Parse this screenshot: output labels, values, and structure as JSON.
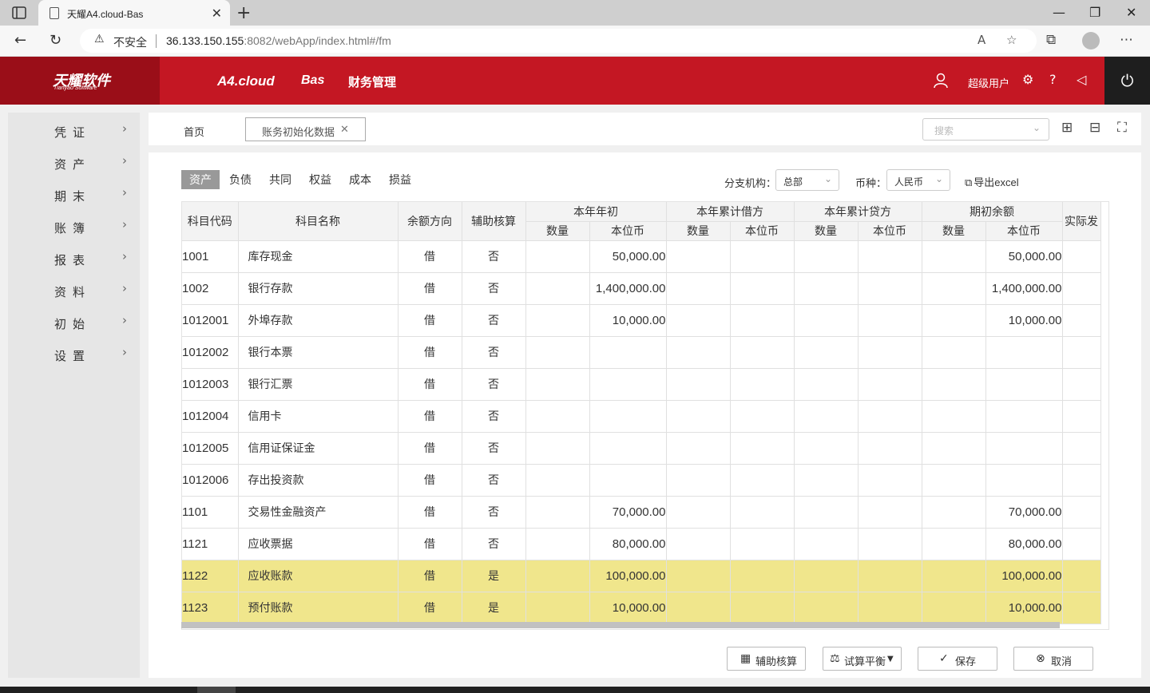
{
  "browser": {
    "tab_title": "天耀A4.cloud-Bas",
    "insecure_label": "不安全",
    "url_host": "36.133.150.155",
    "url_rest": ":8082/webApp/index.html#/fm"
  },
  "header": {
    "logo_text": "天耀软件",
    "logo_sub": "Tianyao Software",
    "nav": [
      "A4.cloud",
      "Bas",
      "财务管理"
    ],
    "user": "超级用户"
  },
  "sidebar": {
    "items": [
      {
        "label": "凭证"
      },
      {
        "label": "资产"
      },
      {
        "label": "期末"
      },
      {
        "label": "账簿"
      },
      {
        "label": "报表"
      },
      {
        "label": "资料"
      },
      {
        "label": "初始"
      },
      {
        "label": "设置"
      }
    ]
  },
  "pagetabs": {
    "home": "首页",
    "active": "账务初始化数据",
    "search_placeholder": "搜索"
  },
  "filters": {
    "categories": [
      "资产",
      "负债",
      "共同",
      "权益",
      "成本",
      "损益"
    ],
    "branch_label": "分支机构：",
    "branch_value": "总部",
    "currency_label": "币种：",
    "currency_value": "人民币",
    "export_label": "导出excel"
  },
  "table": {
    "headers": {
      "code": "科目代码",
      "name": "科目名称",
      "direction": "余额方向",
      "aux": "辅助核算",
      "group_begin": "本年年初",
      "group_debit": "本年累计借方",
      "group_credit": "本年累计贷方",
      "group_opening": "期初余额",
      "actual": "实际发",
      "qty": "数量",
      "base": "本位币"
    },
    "rows": [
      {
        "code": "1001",
        "name": "库存现金",
        "dir": "借",
        "aux": "否",
        "begin_base": "50,000.00",
        "open_base": "50,000.00",
        "hl": false
      },
      {
        "code": "1002",
        "name": "银行存款",
        "dir": "借",
        "aux": "否",
        "begin_base": "1,400,000.00",
        "open_base": "1,400,000.00",
        "hl": false
      },
      {
        "code": "1012001",
        "name": "外埠存款",
        "dir": "借",
        "aux": "否",
        "begin_base": "10,000.00",
        "open_base": "10,000.00",
        "hl": false
      },
      {
        "code": "1012002",
        "name": "银行本票",
        "dir": "借",
        "aux": "否",
        "begin_base": "",
        "open_base": "",
        "hl": false
      },
      {
        "code": "1012003",
        "name": "银行汇票",
        "dir": "借",
        "aux": "否",
        "begin_base": "",
        "open_base": "",
        "hl": false
      },
      {
        "code": "1012004",
        "name": "信用卡",
        "dir": "借",
        "aux": "否",
        "begin_base": "",
        "open_base": "",
        "hl": false
      },
      {
        "code": "1012005",
        "name": "信用证保证金",
        "dir": "借",
        "aux": "否",
        "begin_base": "",
        "open_base": "",
        "hl": false
      },
      {
        "code": "1012006",
        "name": "存出投资款",
        "dir": "借",
        "aux": "否",
        "begin_base": "",
        "open_base": "",
        "hl": false
      },
      {
        "code": "1101",
        "name": "交易性金融资产",
        "dir": "借",
        "aux": "否",
        "begin_base": "70,000.00",
        "open_base": "70,000.00",
        "hl": false
      },
      {
        "code": "1121",
        "name": "应收票据",
        "dir": "借",
        "aux": "否",
        "begin_base": "80,000.00",
        "open_base": "80,000.00",
        "hl": false
      },
      {
        "code": "1122",
        "name": "应收账款",
        "dir": "借",
        "aux": "是",
        "begin_base": "100,000.00",
        "open_base": "100,000.00",
        "hl": true
      },
      {
        "code": "1123",
        "name": "预付账款",
        "dir": "借",
        "aux": "是",
        "begin_base": "10,000.00",
        "open_base": "10,000.00",
        "hl": true
      }
    ]
  },
  "buttons": {
    "aux": "辅助核算",
    "trial": "试算平衡",
    "save": "保存",
    "cancel": "取消"
  },
  "colors": {
    "brand_red": "#c41723",
    "brand_dark": "#9a0e18",
    "highlight_row": "#f0e68c"
  }
}
